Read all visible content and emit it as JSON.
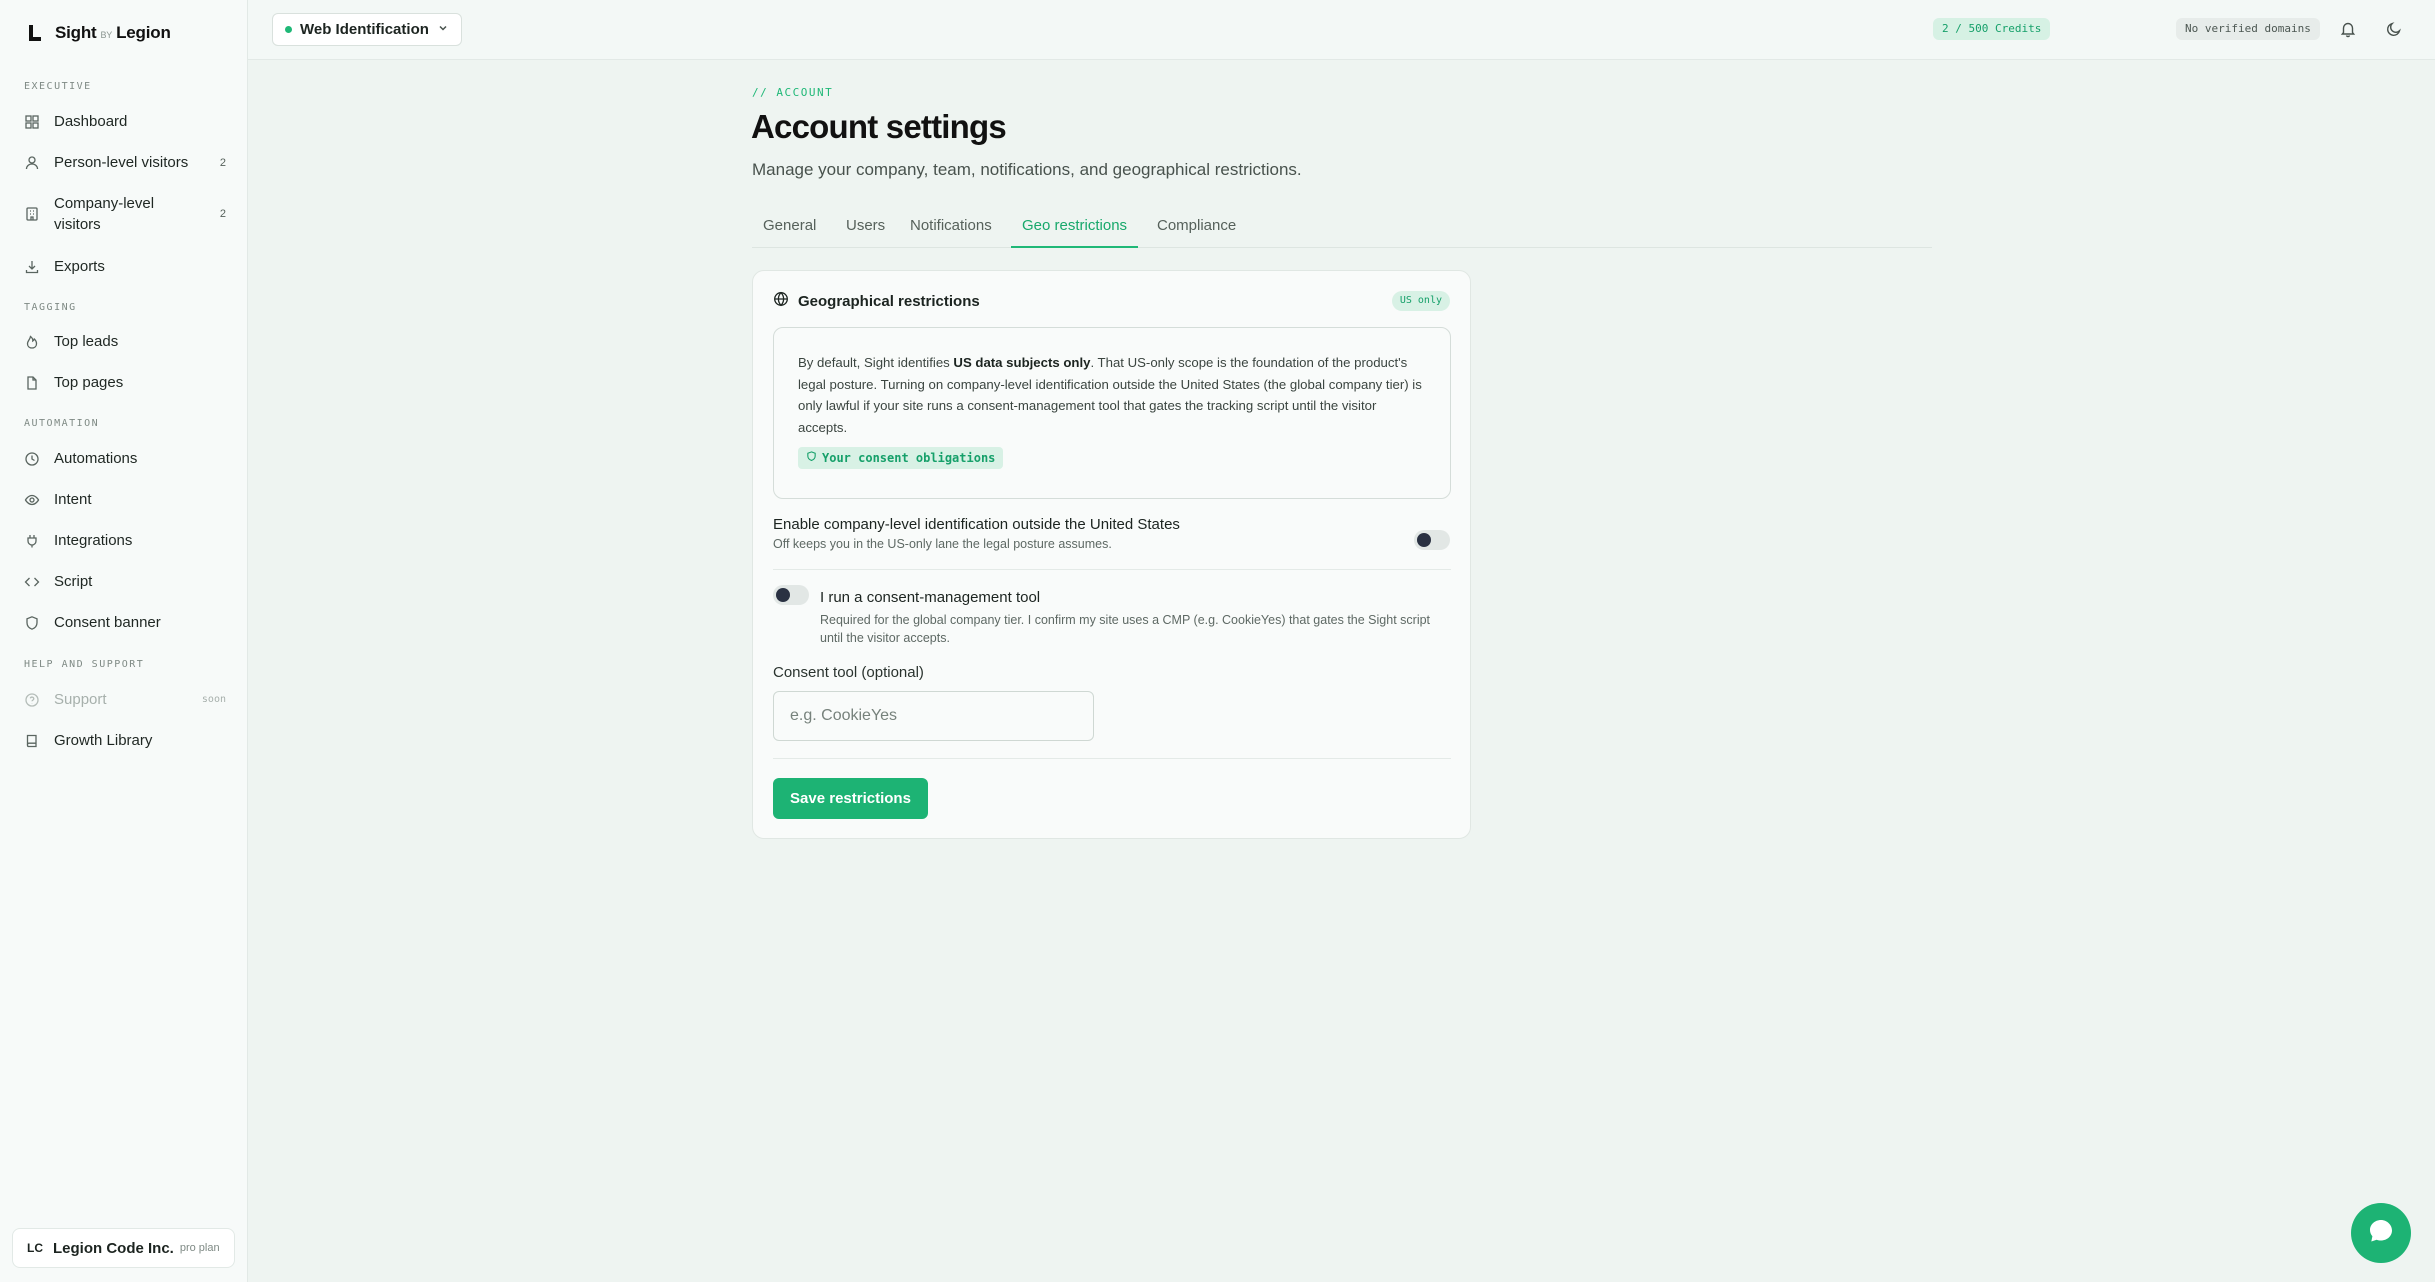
{
  "brand": {
    "name": "Sight",
    "by": "BY",
    "org": "Legion"
  },
  "sidebar": {
    "sections": [
      {
        "label": "EXECUTIVE"
      },
      {
        "label": "TAGGING"
      },
      {
        "label": "AUTOMATION"
      },
      {
        "label": "HELP AND SUPPORT"
      }
    ],
    "items": [
      {
        "label": "Dashboard",
        "icon": "grid-icon"
      },
      {
        "label": "Person-level visitors",
        "count": "2",
        "icon": "person-icon"
      },
      {
        "label": "Company-level visitors",
        "count": "2",
        "icon": "building-icon"
      },
      {
        "label": "Exports",
        "icon": "download-icon"
      },
      {
        "label": "Top leads",
        "icon": "flame-icon"
      },
      {
        "label": "Top pages",
        "icon": "file-icon"
      },
      {
        "label": "Automations",
        "icon": "clock-icon"
      },
      {
        "label": "Intent",
        "icon": "eye-icon"
      },
      {
        "label": "Integrations",
        "icon": "plug-icon"
      },
      {
        "label": "Script",
        "icon": "code-icon"
      },
      {
        "label": "Consent banner",
        "icon": "shield-icon"
      },
      {
        "label": "Support",
        "badge": "soon",
        "icon": "help-icon"
      },
      {
        "label": "Growth Library",
        "icon": "book-icon"
      }
    ],
    "org": {
      "initials": "LC",
      "name": "Legion Code Inc.",
      "plan": "pro plan"
    }
  },
  "topbar": {
    "product": "Web Identification",
    "credits": "2 / 500 Credits",
    "domains": "No verified domains"
  },
  "page": {
    "breadcrumb": "// ACCOUNT",
    "title": "Account settings",
    "subtitle": "Manage your company, team, notifications, and geographical restrictions."
  },
  "tabs": [
    {
      "label": "General"
    },
    {
      "label": "Users"
    },
    {
      "label": "Notifications"
    },
    {
      "label": "Geo restrictions",
      "active": true
    },
    {
      "label": "Compliance"
    }
  ],
  "geo": {
    "title": "Geographical restrictions",
    "badge": "US only",
    "notice_pre": "By default, Sight identifies ",
    "notice_bold": "US data subjects only",
    "notice_post": ". That US-only scope is the foundation of the product's legal posture. Turning on company-level identification outside the United States (the global company tier) is only lawful if your site runs a consent-management tool that gates the tracking script until the visitor accepts.",
    "obligations_link": "Your consent obligations",
    "outside_us_title": "Enable company-level identification outside the United States",
    "outside_us_sub": "Off keeps you in the US-only lane the legal posture assumes.",
    "outside_us_enabled": false,
    "cmp_title": "I run a consent-management tool",
    "cmp_sub": "Required for the global company tier. I confirm my site uses a CMP (e.g. CookieYes) that gates the Sight script until the visitor accepts.",
    "cmp_enabled": false,
    "consent_tool_label": "Consent tool (optional)",
    "consent_tool_placeholder": "e.g. CookieYes",
    "consent_tool_value": "",
    "save_label": "Save restrictions"
  },
  "colors": {
    "accent": "#1fb877",
    "accent_dark": "#16a06a",
    "badge_bg": "#d8f1e5"
  }
}
